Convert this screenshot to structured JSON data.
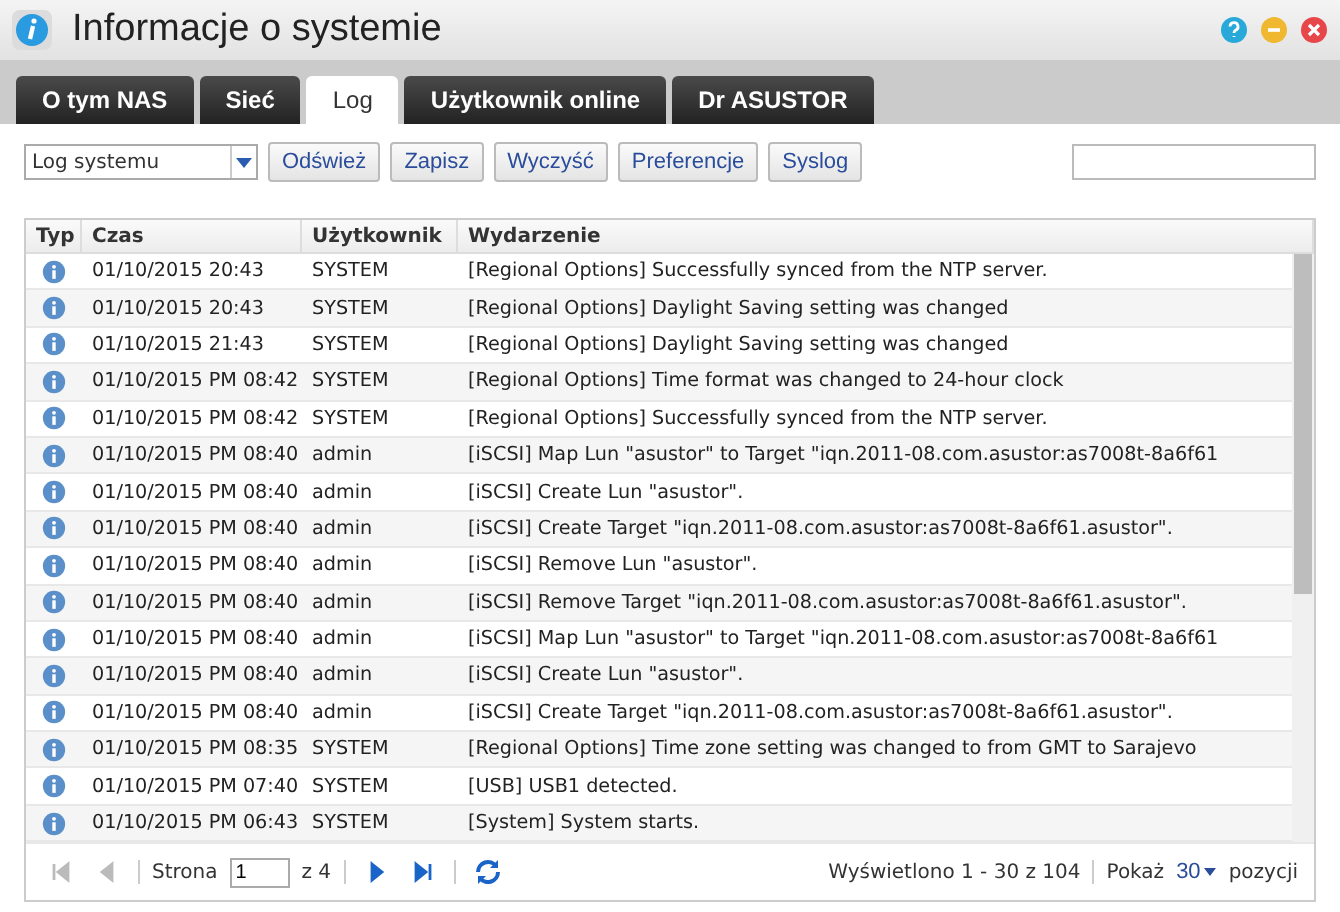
{
  "window": {
    "title": "Informacje o systemie"
  },
  "tabs": [
    {
      "label": "O tym NAS",
      "selected": false
    },
    {
      "label": "Sieć",
      "selected": false
    },
    {
      "label": "Log",
      "selected": true
    },
    {
      "label": "Użytkownik online",
      "selected": false
    },
    {
      "label": "Dr ASUSTOR",
      "selected": false
    }
  ],
  "toolbar": {
    "log_select": "Log systemu",
    "buttons": [
      "Odśwież",
      "Zapisz",
      "Wyczyść",
      "Preferencje",
      "Syslog"
    ]
  },
  "table": {
    "columns": [
      "Typ",
      "Czas",
      "Użytkownik",
      "Wydarzenie"
    ],
    "rows": [
      {
        "time": "01/10/2015 20:43",
        "user": "SYSTEM",
        "event": "[Regional Options] Successfully synced from the NTP server."
      },
      {
        "time": "01/10/2015 20:43",
        "user": "SYSTEM",
        "event": "[Regional Options] Daylight Saving setting was changed"
      },
      {
        "time": "01/10/2015 21:43",
        "user": "SYSTEM",
        "event": "[Regional Options] Daylight Saving setting was changed"
      },
      {
        "time": "01/10/2015 PM 08:42",
        "user": "SYSTEM",
        "event": "[Regional Options] Time format was changed to 24-hour clock"
      },
      {
        "time": "01/10/2015 PM 08:42",
        "user": "SYSTEM",
        "event": "[Regional Options] Successfully synced from the NTP server."
      },
      {
        "time": "01/10/2015 PM 08:40",
        "user": "admin",
        "event": "[iSCSI] Map Lun \"asustor\" to Target \"iqn.2011-08.com.asustor:as7008t-8a6f61"
      },
      {
        "time": "01/10/2015 PM 08:40",
        "user": "admin",
        "event": "[iSCSI] Create Lun \"asustor\"."
      },
      {
        "time": "01/10/2015 PM 08:40",
        "user": "admin",
        "event": "[iSCSI] Create Target \"iqn.2011-08.com.asustor:as7008t-8a6f61.asustor\"."
      },
      {
        "time": "01/10/2015 PM 08:40",
        "user": "admin",
        "event": "[iSCSI] Remove Lun \"asustor\"."
      },
      {
        "time": "01/10/2015 PM 08:40",
        "user": "admin",
        "event": "[iSCSI] Remove Target \"iqn.2011-08.com.asustor:as7008t-8a6f61.asustor\"."
      },
      {
        "time": "01/10/2015 PM 08:40",
        "user": "admin",
        "event": "[iSCSI] Map Lun \"asustor\" to Target \"iqn.2011-08.com.asustor:as7008t-8a6f61"
      },
      {
        "time": "01/10/2015 PM 08:40",
        "user": "admin",
        "event": "[iSCSI] Create Lun \"asustor\"."
      },
      {
        "time": "01/10/2015 PM 08:40",
        "user": "admin",
        "event": "[iSCSI] Create Target \"iqn.2011-08.com.asustor:as7008t-8a6f61.asustor\"."
      },
      {
        "time": "01/10/2015 PM 08:35",
        "user": "SYSTEM",
        "event": "[Regional Options] Time zone setting was changed to from GMT to Sarajevo"
      },
      {
        "time": "01/10/2015 PM 07:40",
        "user": "SYSTEM",
        "event": "[USB] USB1 detected."
      },
      {
        "time": "01/10/2015 PM 06:43",
        "user": "SYSTEM",
        "event": "[System] System starts."
      }
    ]
  },
  "pager": {
    "nav_back": [
      {
        "kind": "first",
        "disabled": true
      },
      {
        "kind": "prev",
        "disabled": true
      }
    ],
    "page_label": "Strona",
    "page": "1",
    "of": "z 4",
    "nav_forward": [
      {
        "kind": "next",
        "disabled": false
      },
      {
        "kind": "last",
        "disabled": false
      }
    ],
    "summary": "Wyświetlono 1 - 30 z 104",
    "show_label": "Pokaż",
    "page_size": "30",
    "items_label": "pozycji"
  }
}
